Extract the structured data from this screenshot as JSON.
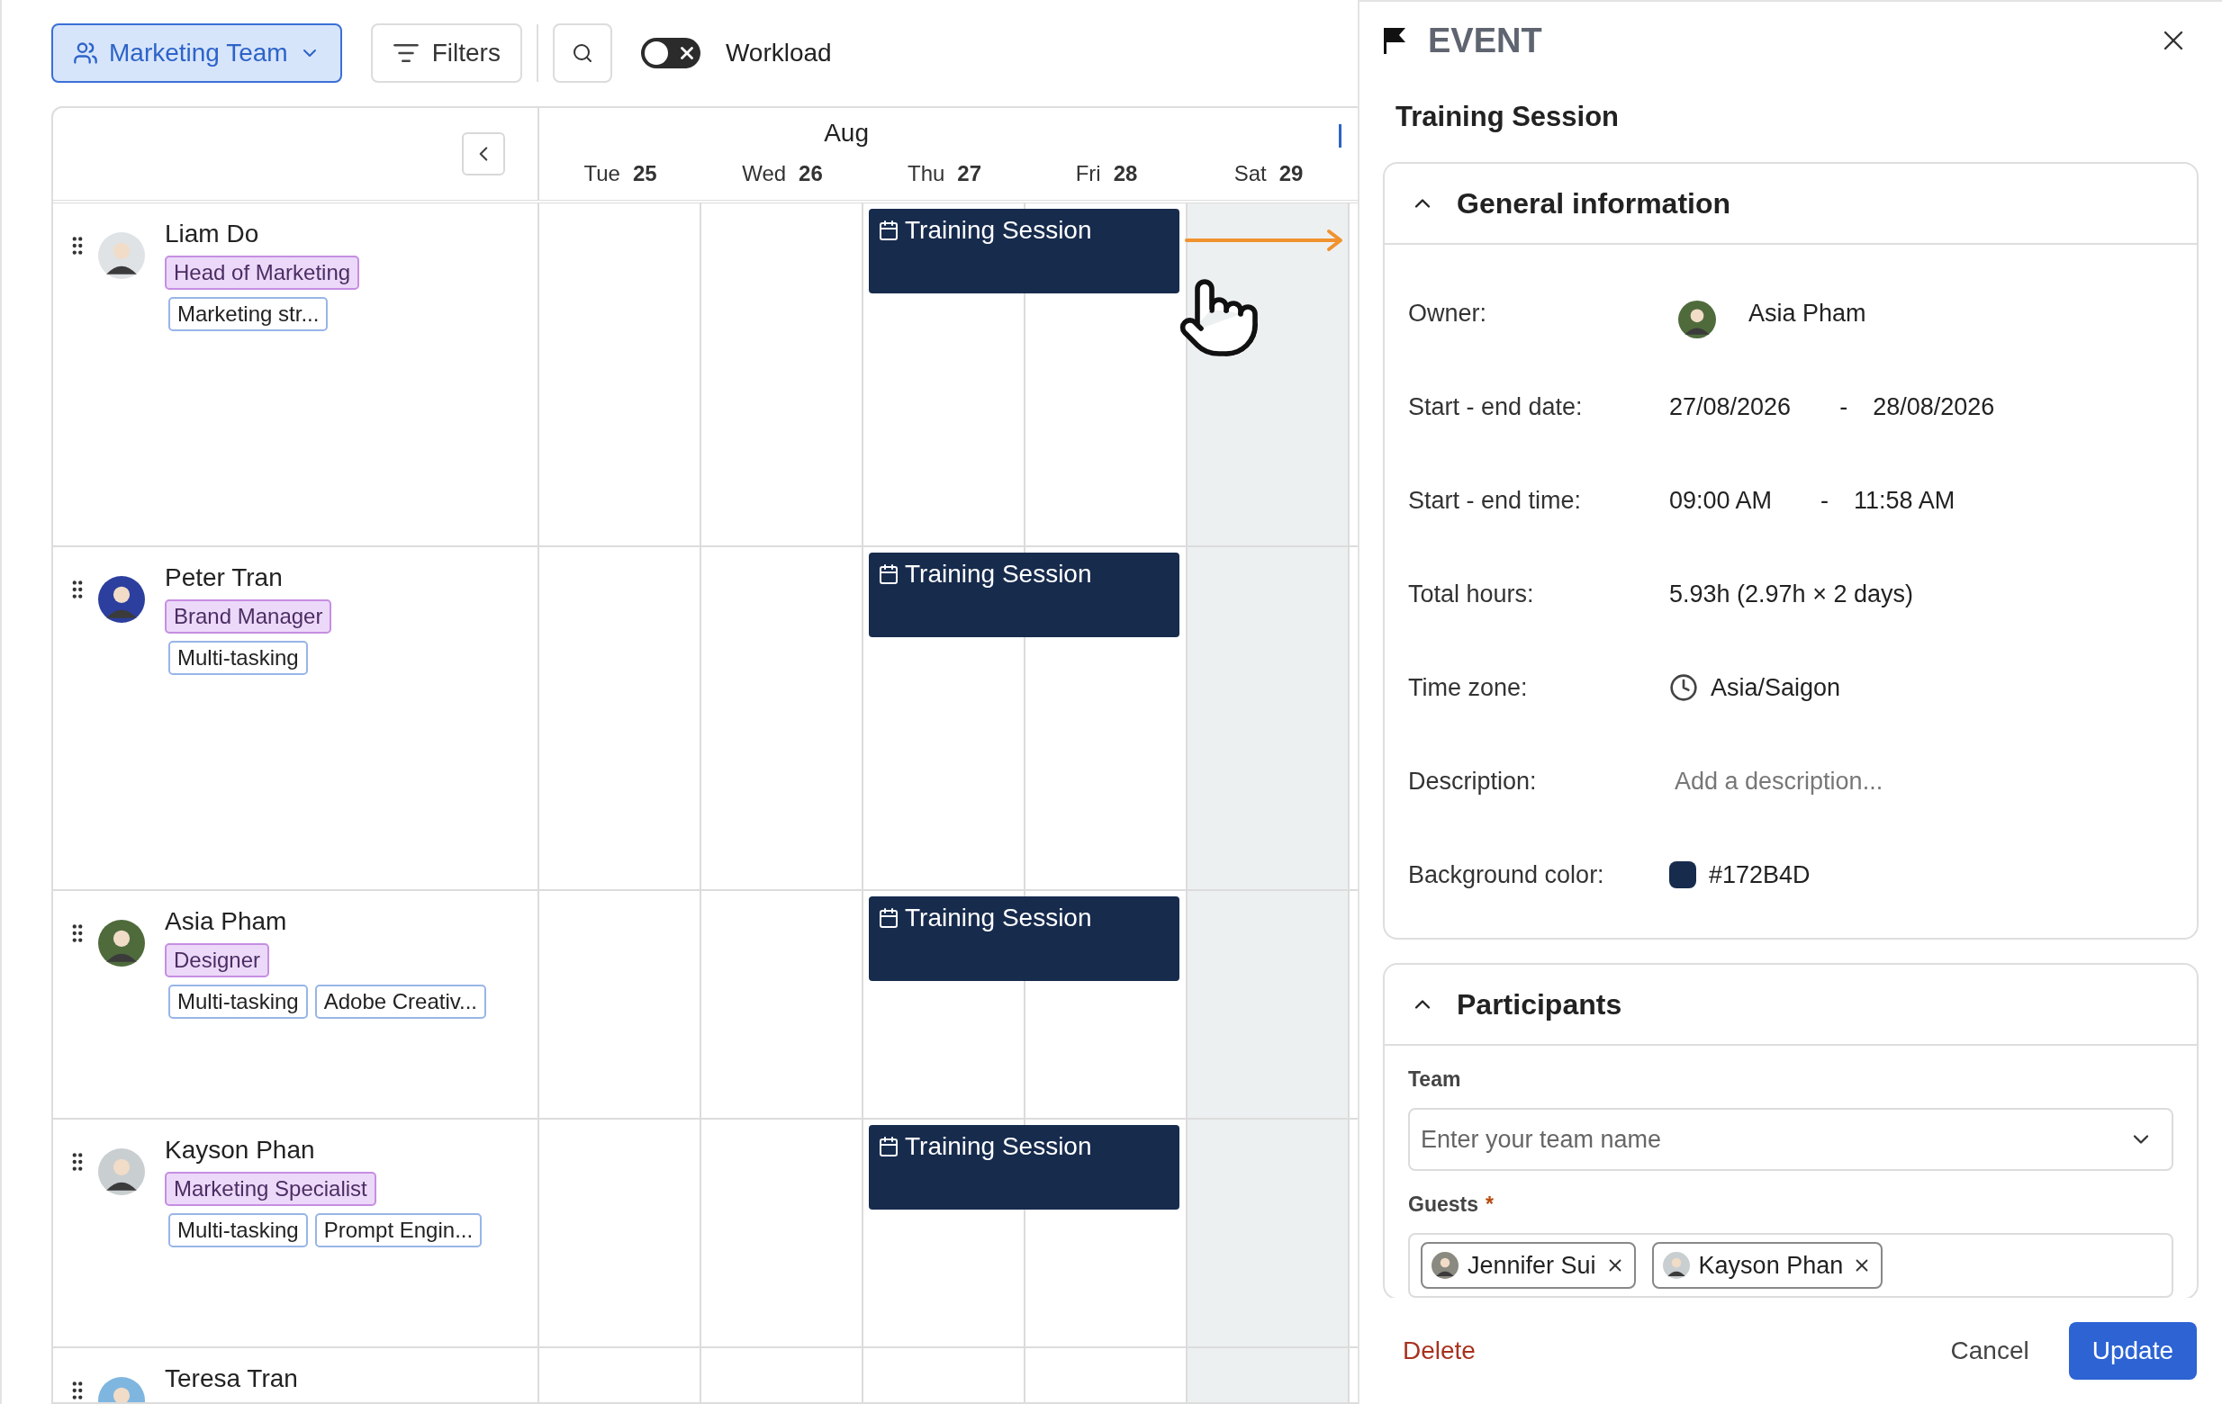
{
  "toolbar": {
    "team_button": "Marketing Team",
    "filters_button": "Filters",
    "workload_toggle": {
      "label": "Workload",
      "on": false
    }
  },
  "calendar": {
    "month": "Aug",
    "days": [
      {
        "weekday": "Tue",
        "date": "25",
        "weekend": false
      },
      {
        "weekday": "Wed",
        "date": "26",
        "weekend": false
      },
      {
        "weekday": "Thu",
        "date": "27",
        "weekend": false
      },
      {
        "weekday": "Fri",
        "date": "28",
        "weekend": false
      },
      {
        "weekday": "Sat",
        "date": "29",
        "weekend": true
      }
    ],
    "people": [
      {
        "name": "Liam Do",
        "role": "Head of Marketing",
        "skills": [
          "Marketing str..."
        ],
        "event": {
          "title": "Training Session"
        }
      },
      {
        "name": "Peter Tran",
        "role": "Brand Manager",
        "skills": [
          "Multi-tasking"
        ],
        "event": {
          "title": "Training Session"
        }
      },
      {
        "name": "Asia Pham",
        "role": "Designer",
        "skills": [
          "Multi-tasking",
          "Adobe Creativ..."
        ],
        "event": {
          "title": "Training Session"
        }
      },
      {
        "name": "Kayson Phan",
        "role": "Marketing Specialist",
        "skills": [
          "Multi-tasking",
          "Prompt Engin..."
        ],
        "event": {
          "title": "Training Session"
        }
      },
      {
        "name": "Teresa Tran"
      }
    ]
  },
  "event_panel": {
    "kind_label": "EVENT",
    "title": "Training Session",
    "general": {
      "heading": "General information",
      "expanded": true,
      "fields": [
        {
          "kind": "person",
          "label": "Owner:",
          "value": "Asia Pham"
        },
        {
          "kind": "range",
          "label": "Start - end date:",
          "start": "27/08/2026",
          "separator": "-",
          "end": "28/08/2026"
        },
        {
          "kind": "range",
          "label": "Start - end time:",
          "start": "09:00 AM",
          "separator": "-",
          "end": "11:58 AM"
        },
        {
          "kind": "text",
          "label": "Total hours:",
          "value": "5.93h (2.97h × 2 days)"
        },
        {
          "kind": "timezone",
          "label": "Time zone:",
          "value": "Asia/Saigon"
        },
        {
          "kind": "placeholder",
          "label": "Description:",
          "placeholder": "Add a description..."
        },
        {
          "kind": "color",
          "label": "Background color:",
          "value": "#172B4D",
          "color": "#172b4d"
        }
      ]
    },
    "participants": {
      "heading": "Participants",
      "expanded": true,
      "team_label": "Team",
      "team_placeholder": "Enter your team name",
      "guests_label": "Guests",
      "required_mark": "*",
      "guests": [
        "Jennifer Sui",
        "Kayson Phan"
      ]
    },
    "footer": {
      "delete": "Delete",
      "cancel": "Cancel",
      "update": "Update"
    }
  }
}
